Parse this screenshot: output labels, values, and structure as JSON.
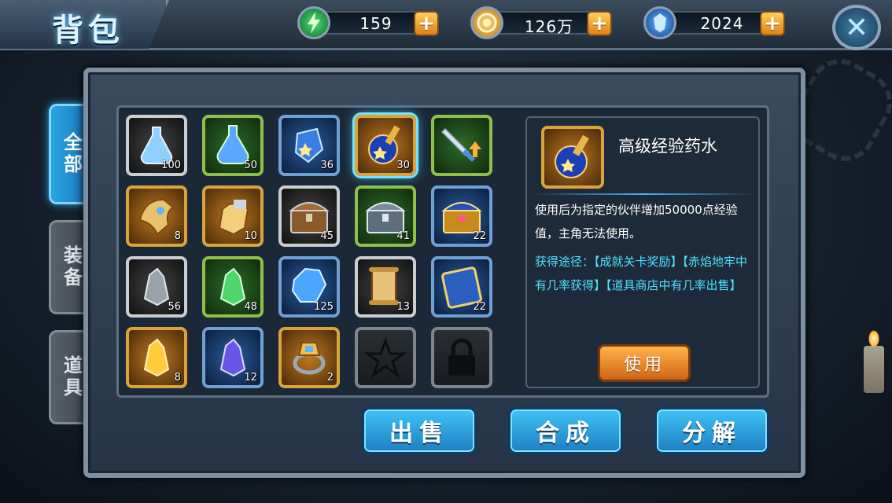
{
  "header": {
    "title": "背包",
    "resources": [
      {
        "name": "stamina",
        "icon": "lightning-icon",
        "value": "159",
        "color": "#3fd46b"
      },
      {
        "name": "gold",
        "icon": "coin-icon",
        "value": "126万",
        "color": "#f2b631"
      },
      {
        "name": "gem",
        "icon": "crystal-icon",
        "value": "2024",
        "color": "#3a8df0"
      }
    ],
    "plus_label": "+",
    "close_label": "✕"
  },
  "tabs": [
    {
      "label": "全部",
      "active": true
    },
    {
      "label": "装备",
      "active": false
    },
    {
      "label": "道具",
      "active": false
    }
  ],
  "inventory": [
    {
      "name": "potion-bottle-white",
      "icon": "flask-icon",
      "rarity": "white",
      "count": "100"
    },
    {
      "name": "potion-bottle-green",
      "icon": "flask-icon",
      "rarity": "green",
      "count": "50"
    },
    {
      "name": "star-potion",
      "icon": "star-bottle-icon",
      "rarity": "blue",
      "count": "36"
    },
    {
      "name": "advanced-exp-potion",
      "icon": "potion-bag-icon",
      "rarity": "gold",
      "count": "30",
      "selected": true
    },
    {
      "name": "sword-upgrade",
      "icon": "sword-icon",
      "rarity": "green",
      "count": ""
    },
    {
      "name": "gold-armor-piece",
      "icon": "shoulder-armor-icon",
      "rarity": "gold",
      "count": "8"
    },
    {
      "name": "gold-gauntlet",
      "icon": "gauntlet-icon",
      "rarity": "gold",
      "count": "10"
    },
    {
      "name": "wooden-chest",
      "icon": "chest-icon",
      "rarity": "white",
      "count": "45"
    },
    {
      "name": "silver-chest",
      "icon": "chest-icon",
      "rarity": "green",
      "count": "41"
    },
    {
      "name": "gold-chest",
      "icon": "chest-icon",
      "rarity": "blue",
      "count": "22"
    },
    {
      "name": "gray-crystal",
      "icon": "crystal-icon",
      "rarity": "white",
      "count": "56"
    },
    {
      "name": "green-crystal",
      "icon": "crystal-icon",
      "rarity": "green",
      "count": "48"
    },
    {
      "name": "blue-gem",
      "icon": "gem-icon",
      "rarity": "blue",
      "count": "125"
    },
    {
      "name": "scroll",
      "icon": "scroll-icon",
      "rarity": "white",
      "count": "13"
    },
    {
      "name": "blue-card",
      "icon": "card-icon",
      "rarity": "blue",
      "count": "22"
    },
    {
      "name": "gold-crystal",
      "icon": "crystal-icon",
      "rarity": "gold",
      "count": "8"
    },
    {
      "name": "purple-crystal",
      "icon": "crystal-icon",
      "rarity": "blue",
      "count": "12"
    },
    {
      "name": "gold-ring",
      "icon": "ring-icon",
      "rarity": "gold",
      "count": "2"
    },
    {
      "name": "empty-slot",
      "icon": "star-outline-icon",
      "rarity": "gray",
      "count": ""
    },
    {
      "name": "locked-slot",
      "icon": "lock-icon",
      "rarity": "gray",
      "count": ""
    }
  ],
  "detail": {
    "name": "高级经验药水",
    "description": "使用后为指定的伙伴增加50000点经验值，主角无法使用。",
    "source": "获得途径：【成就关卡奖励】【赤焰地牢中有几率获得】【道具商店中有几率出售】",
    "use_label": "使用"
  },
  "actions": {
    "sell_label": "出售",
    "compose_label": "合成",
    "decompose_label": "分解"
  }
}
